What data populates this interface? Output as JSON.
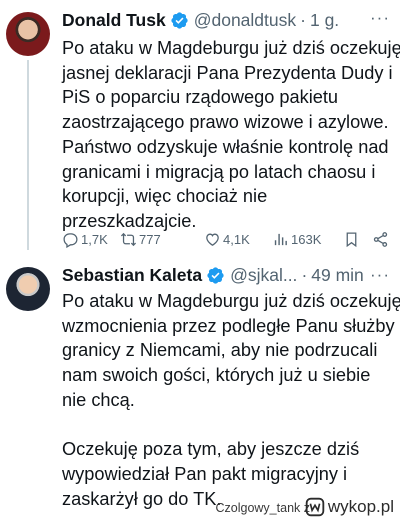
{
  "tweets": [
    {
      "name": "Donald Tusk",
      "handle": "@donaldtusk",
      "separator": "·",
      "time": "1 g.",
      "more": "···",
      "lines": [
        "Po ataku w Magdeburgu już dziś oczekuję",
        "jasnej deklaracji Pana Prezydenta Dudy i",
        "PiS o poparciu rządowego pakietu",
        "zaostrzającego prawo wizowe i azylowe.",
        "Państwo odzyskuje właśnie kontrolę nad",
        "granicami i migracją po latach chaosu i",
        "korupcji, więc chociaż nie",
        "przeszkadzajcie."
      ],
      "stats": {
        "replies": "1,7K",
        "retweets": "777",
        "likes": "4,1K",
        "views": "163K"
      },
      "icons": [
        "reply-icon",
        "retweet-icon",
        "like-icon",
        "views-icon",
        "bookmark-icon",
        "share-icon"
      ]
    },
    {
      "name": "Sebastian Kaleta",
      "handle": "@sjkal...",
      "separator": "·",
      "time": "49 min",
      "more": "···",
      "paragraphs": [
        [
          "Po ataku w Magdeburgu już dziś oczekuję",
          "wzmocnienia przez podległe Panu służby",
          "granicy z Niemcami, aby nie podrzucali",
          "nam swoich gości, których już u siebie",
          "nie chcą."
        ],
        [
          "Oczekuję poza tym, aby jeszcze dziś",
          "wypowiedział Pan pakt migracyjny i",
          "zaskarżył go do TK."
        ]
      ]
    }
  ],
  "footer": {
    "user": "Czolgowy_tank z",
    "logo": "wykop.pl"
  },
  "colors": {
    "verified": "#1d9bf0",
    "muted": "#536471",
    "text": "#0f1419"
  }
}
